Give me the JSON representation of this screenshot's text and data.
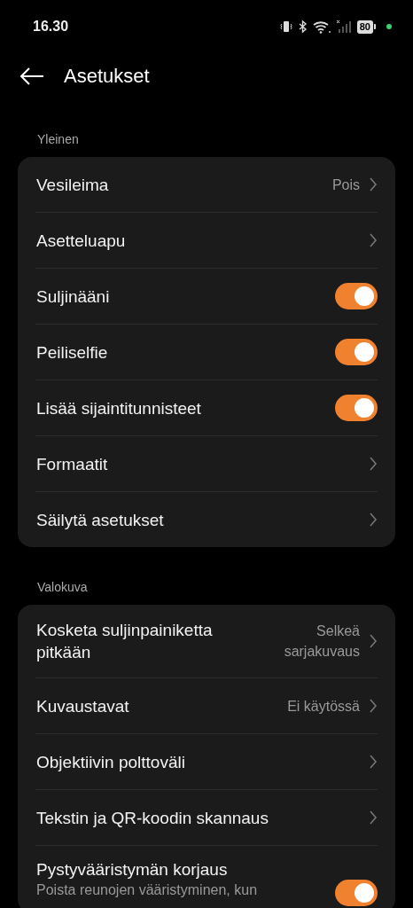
{
  "status_bar": {
    "time": "16.30",
    "battery": "80"
  },
  "header": {
    "title": "Asetukset"
  },
  "sections": [
    {
      "title": "Yleinen",
      "rows": [
        {
          "kind": "link",
          "label": "Vesileima",
          "value": "Pois"
        },
        {
          "kind": "link",
          "label": "Asetteluapu"
        },
        {
          "kind": "toggle",
          "label": "Suljinääni",
          "on": true
        },
        {
          "kind": "toggle",
          "label": "Peiliselfie",
          "on": true
        },
        {
          "kind": "toggle",
          "label": "Lisää sijaintitunnisteet",
          "on": true
        },
        {
          "kind": "link",
          "label": "Formaatit"
        },
        {
          "kind": "link",
          "label": "Säilytä asetukset"
        }
      ]
    },
    {
      "title": "Valokuva",
      "rows": [
        {
          "kind": "link",
          "label": "Kosketa suljinpainiketta pitkään",
          "value": "Selkeä sarjakuvaus"
        },
        {
          "kind": "link",
          "label": "Kuvaustavat",
          "value": "Ei käytössä"
        },
        {
          "kind": "link",
          "label": "Objektiivin polttoväli"
        },
        {
          "kind": "link",
          "label": "Tekstin ja QR-koodin skannaus"
        },
        {
          "kind": "toggle",
          "label": "Pystyvääristymän korjaus",
          "subtitle": "Poista reunojen vääristyminen, kun",
          "on": true
        }
      ]
    }
  ]
}
